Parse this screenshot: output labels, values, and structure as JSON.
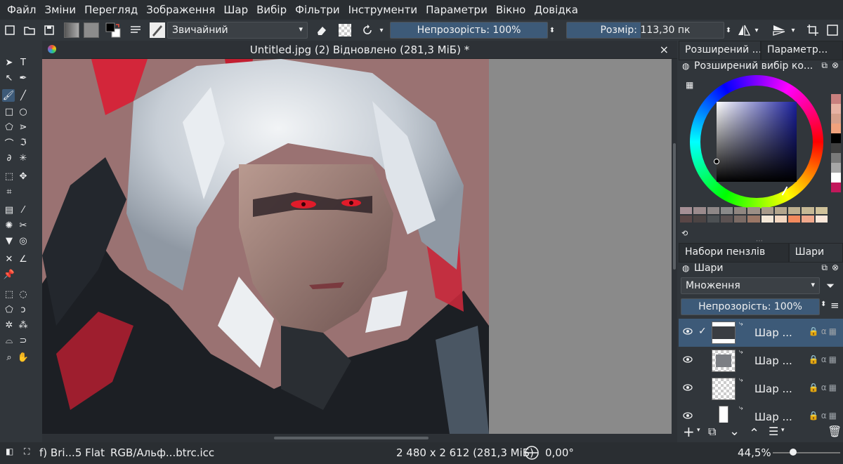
{
  "menu": [
    "Файл",
    "Зміни",
    "Перегляд",
    "Зображення",
    "Шар",
    "Вибір",
    "Фільтри",
    "Інструменти",
    "Параметри",
    "Вікно",
    "Довідка"
  ],
  "toolbar": {
    "brush_preset": "Звичайний",
    "opacity_label": "Непрозорість: 100%",
    "opacity_value": 1.0,
    "size_label": "Розмір: 113,30 пк",
    "size_fraction": 0.47
  },
  "document": {
    "title": "Untitled.jpg (2) Відновлено (281,3 МіБ) *",
    "close_glyph": "×"
  },
  "dock": {
    "top_tabs": [
      "Розширений ...",
      "Параметр..."
    ],
    "color_panel_title": "Розширений вибір ко...",
    "history_colors": [
      "#c9807e",
      "#e7b2a3",
      "#d6a08b",
      "#f0a27d",
      "#000000",
      "#3f3f3f",
      "#7a7a7a",
      "#a7a7a7",
      "#ffffff",
      "#c2185b"
    ],
    "palette_row1": [
      "#a58f95",
      "#9a8a8c",
      "#8e8787",
      "#8a8a8a",
      "#908680",
      "#9c8f86",
      "#a89a8b",
      "#b3a58c",
      "#bdaf8f",
      "#c6b895",
      "#d0c29a"
    ],
    "palette_row2": [
      "#5a4646",
      "#4c4444",
      "#4d5154",
      "#5b5252",
      "#7b6b65",
      "#9b7766",
      "#f3e7d7",
      "#f3d7c0",
      "#f28a5d",
      "#f0a88c",
      "#fae7d9"
    ],
    "bottom_tabs": [
      "Набори пензлів",
      "Шари"
    ],
    "layers_title": "Шари",
    "blend_mode": "Множення",
    "layer_opacity_label": "Непрозорість:  100%",
    "layers": [
      {
        "name": "Шар ...",
        "selected": true,
        "checked": "✓"
      },
      {
        "name": "Шар ...",
        "selected": false,
        "checked": ""
      },
      {
        "name": "Шар ...",
        "selected": false,
        "checked": ""
      },
      {
        "name": "Шар ...",
        "selected": false,
        "checked": ""
      }
    ]
  },
  "status": {
    "brush": "f) Bri...5 Flat",
    "color_space": "RGB/Альф...btrc.icc",
    "dimensions": "2 480 x 2 612 (281,3 МіБ)",
    "rotation": "0,00°",
    "zoom": "44,5%"
  },
  "colors": {
    "accent": "#3d5a78",
    "bg": "#31363b",
    "canvas_bg": "#9a7272"
  }
}
